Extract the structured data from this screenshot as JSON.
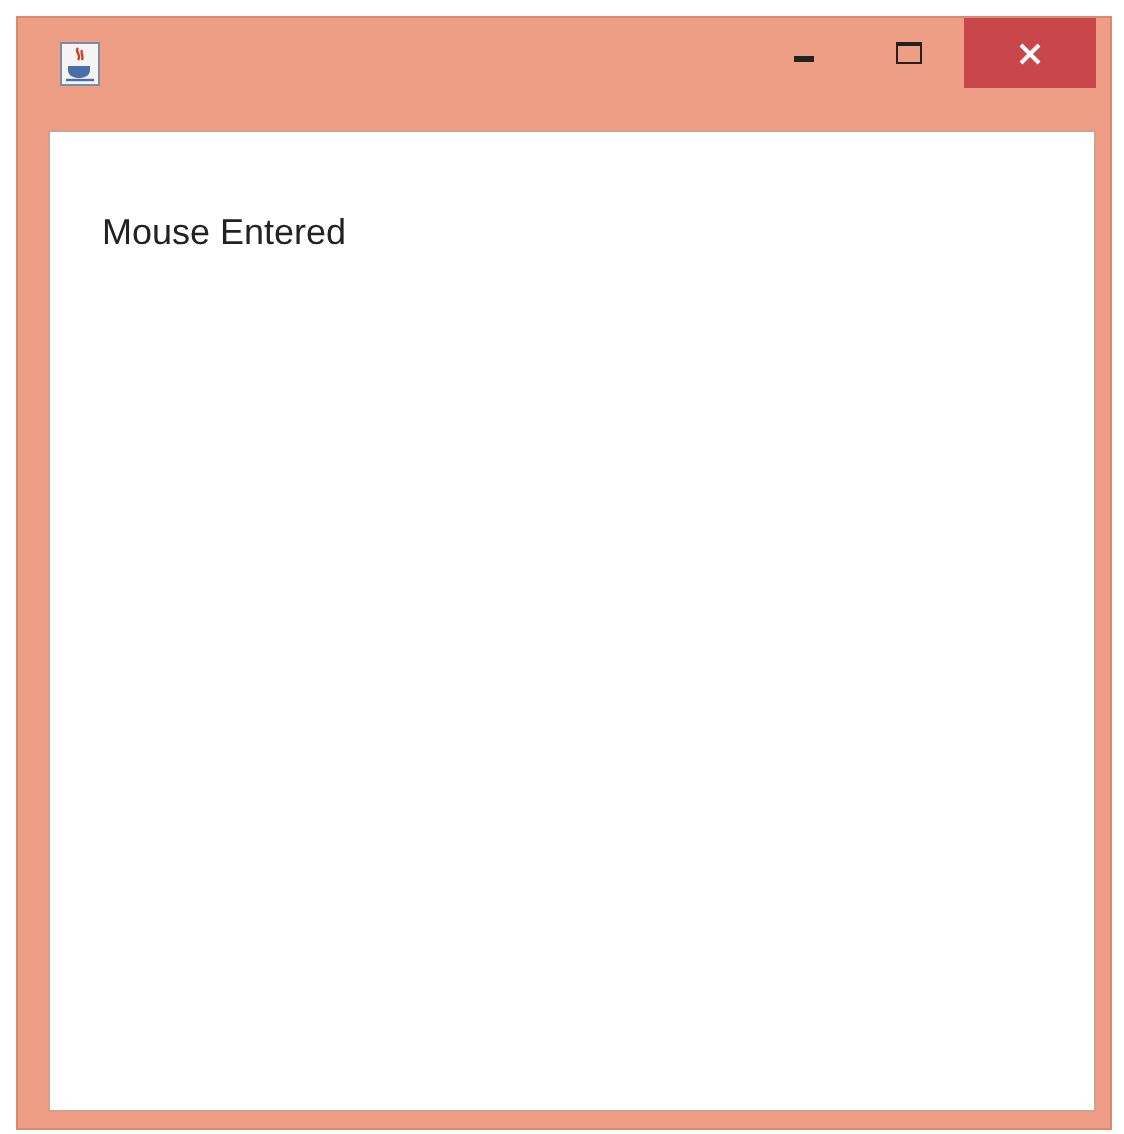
{
  "window": {
    "label": "Mouse Entered"
  }
}
